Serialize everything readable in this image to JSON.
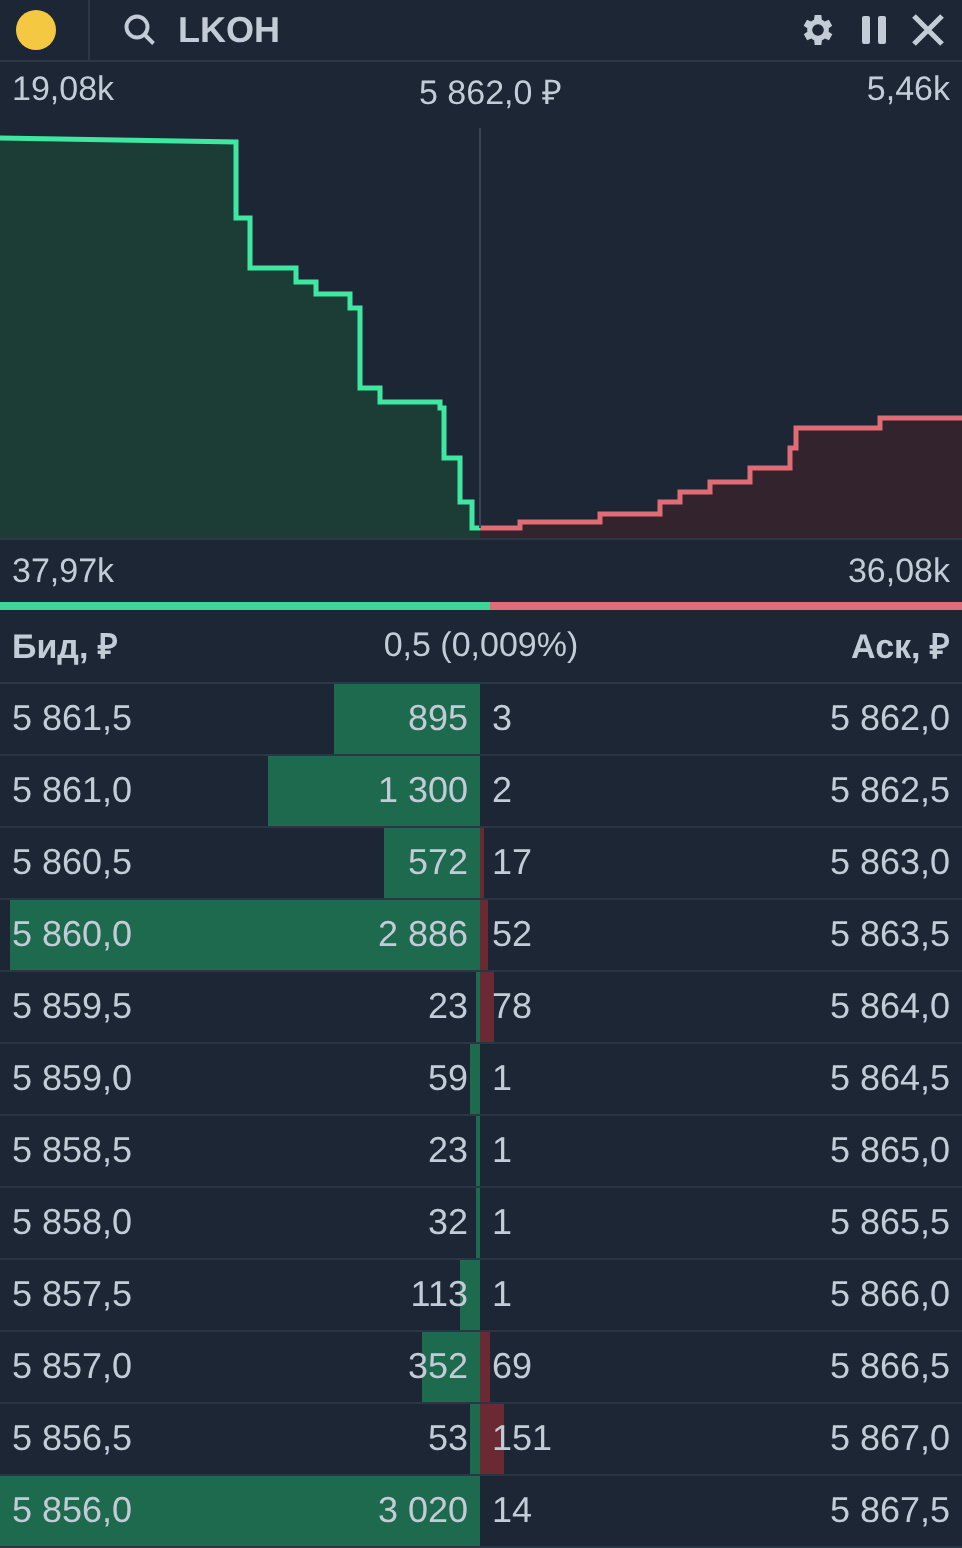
{
  "header": {
    "ticker": "LKOH"
  },
  "summary": {
    "bid_peak": "19,08k",
    "price": "5 862,0 ₽",
    "ask_peak": "5,46k"
  },
  "totals": {
    "bids": "37,97k",
    "asks": "36,08k",
    "level": 0.51
  },
  "columns": {
    "bid": "Бид, ₽",
    "spread": "0,5 (0,009%)",
    "ask": "Аск, ₽"
  },
  "rows": [
    {
      "bid": {
        "price": "5 861,5",
        "volume": "895"
      },
      "ask": {
        "volume": "3",
        "price": "5 862,0"
      }
    },
    {
      "bid": {
        "price": "5 861,0",
        "volume": "1 300"
      },
      "ask": {
        "volume": "2",
        "price": "5 862,5"
      }
    },
    {
      "bid": {
        "price": "5 860,5",
        "volume": "572"
      },
      "ask": {
        "volume": "17",
        "price": "5 863,0"
      }
    },
    {
      "bid": {
        "price": "5 860,0",
        "volume": "2 886"
      },
      "ask": {
        "volume": "52",
        "price": "5 863,5"
      }
    },
    {
      "bid": {
        "price": "5 859,5",
        "volume": "23"
      },
      "ask": {
        "volume": "78",
        "price": "5 864,0"
      }
    },
    {
      "bid": {
        "price": "5 859,0",
        "volume": "59"
      },
      "ask": {
        "volume": "1",
        "price": "5 864,5"
      }
    },
    {
      "bid": {
        "price": "5 858,5",
        "volume": "23"
      },
      "ask": {
        "volume": "1",
        "price": "5 865,0"
      }
    },
    {
      "bid": {
        "price": "5 858,0",
        "volume": "32"
      },
      "ask": {
        "volume": "1",
        "price": "5 865,5"
      }
    },
    {
      "bid": {
        "price": "5 857,5",
        "volume": "113"
      },
      "ask": {
        "volume": "1",
        "price": "5 866,0"
      }
    },
    {
      "bid": {
        "price": "5 857,0",
        "volume": "352"
      },
      "ask": {
        "volume": "69",
        "price": "5 866,5"
      }
    },
    {
      "bid": {
        "price": "5 856,5",
        "volume": "53"
      },
      "ask": {
        "volume": "151",
        "price": "5 867,0"
      }
    },
    {
      "bid": {
        "price": "5 856,0",
        "volume": "3 020"
      },
      "ask": {
        "volume": "14",
        "price": "5 867,5"
      }
    }
  ]
}
